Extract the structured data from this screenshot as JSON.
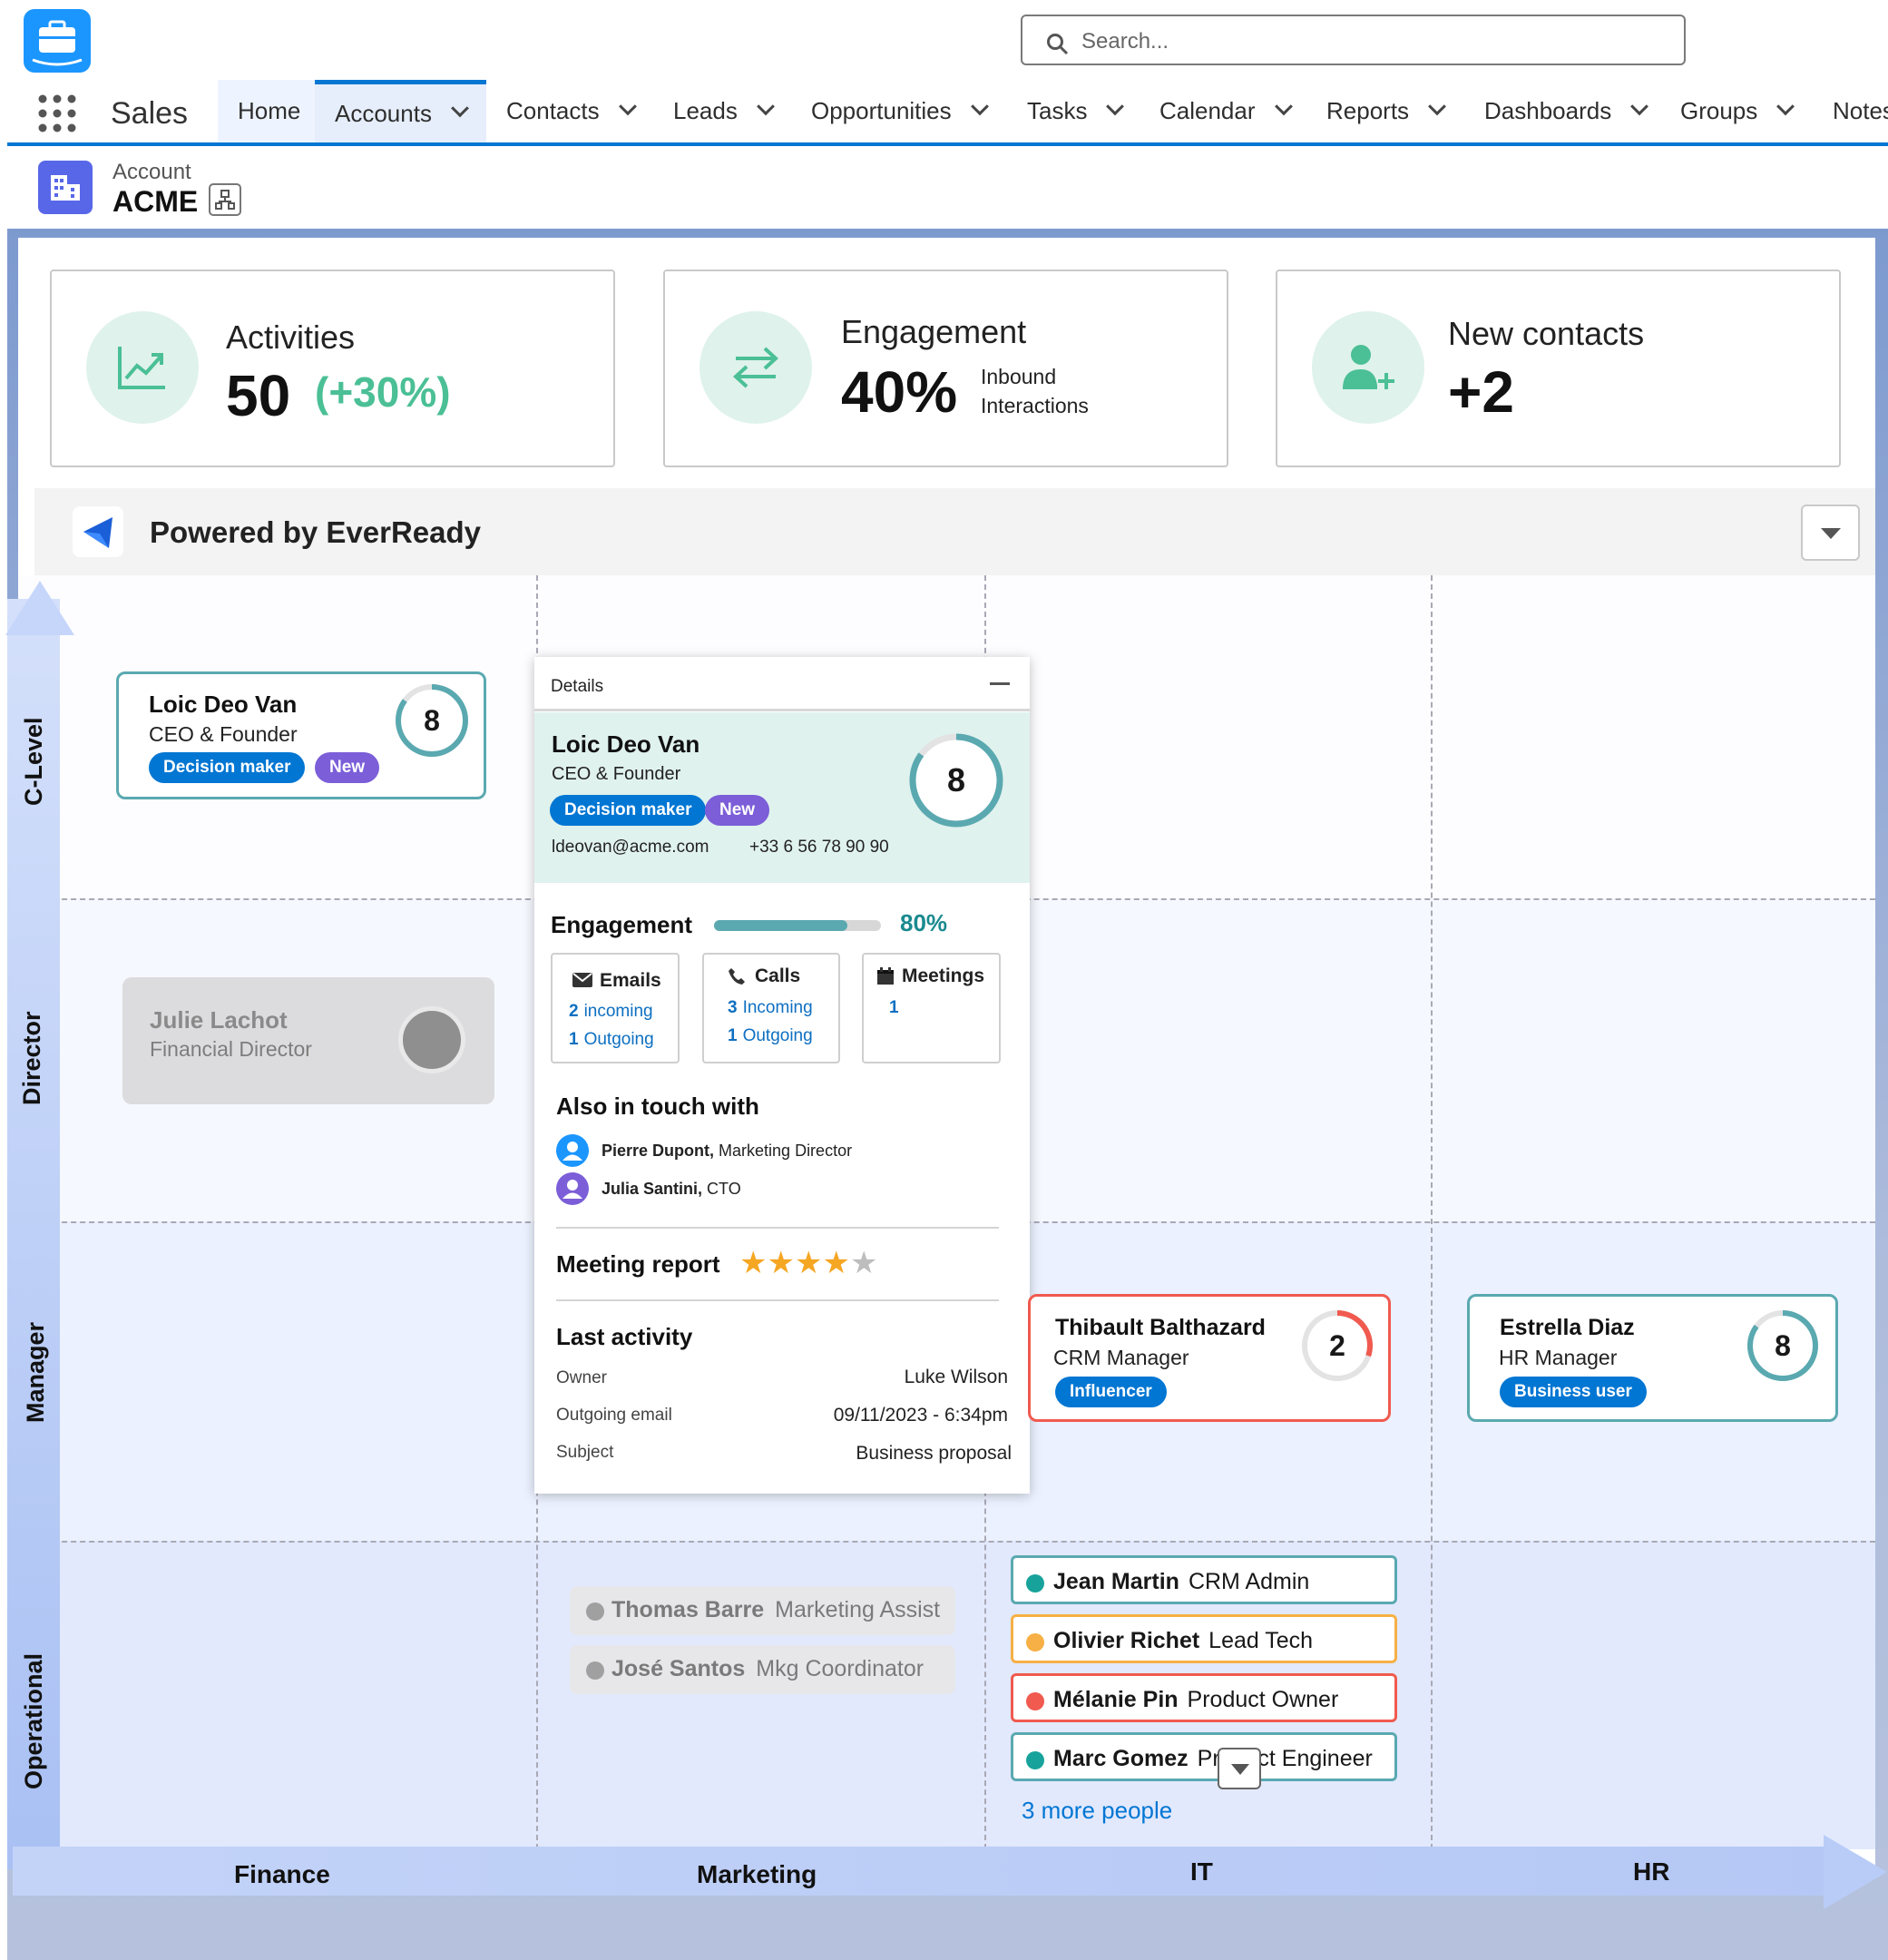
{
  "header": {
    "app_name": "Sales",
    "search_placeholder": "Search...",
    "nav": [
      {
        "label": "Home"
      },
      {
        "label": "Accounts"
      },
      {
        "label": "Contacts"
      },
      {
        "label": "Leads"
      },
      {
        "label": "Opportunities"
      },
      {
        "label": "Tasks"
      },
      {
        "label": "Calendar"
      },
      {
        "label": "Reports"
      },
      {
        "label": "Dashboards"
      },
      {
        "label": "Groups"
      },
      {
        "label": "Notes"
      }
    ]
  },
  "record": {
    "type_label": "Account",
    "name": "ACME"
  },
  "kpis": {
    "activities": {
      "title": "Activities",
      "value": "50",
      "change": "(+30%)"
    },
    "engagement": {
      "title": "Engagement",
      "value": "40%",
      "sub1": "Inbound",
      "sub2": "Interactions"
    },
    "new_contacts": {
      "title": "New contacts",
      "value": "+2"
    }
  },
  "powered_by": "Powered by EverReady",
  "y_axis": [
    "C-Level",
    "Director",
    "Manager",
    "Operational"
  ],
  "x_axis": [
    "Finance",
    "Marketing",
    "IT",
    "HR"
  ],
  "cards": {
    "loic": {
      "name": "Loic Deo Van",
      "role": "CEO & Founder",
      "badges": [
        "Decision maker",
        "New"
      ],
      "score": "8",
      "score_pct": 0.85
    },
    "julie": {
      "name": "Julie Lachot",
      "role": "Financial Director"
    },
    "thibault": {
      "name": "Thibault Balthazard",
      "role": "CRM Manager",
      "badge": "Influencer",
      "score": "2",
      "score_pct": 0.3
    },
    "estrella": {
      "name": "Estrella Diaz",
      "role": "HR Manager",
      "badge": "Business user",
      "score": "8",
      "score_pct": 0.85
    }
  },
  "details": {
    "header": "Details",
    "name": "Loic Deo Van",
    "role": "CEO & Founder",
    "badges": [
      "Decision maker",
      "New"
    ],
    "email": "ldeovan@acme.com",
    "phone": "+33 6 56 78 90 90",
    "score": "8",
    "score_pct": 0.85,
    "engagement_label": "Engagement",
    "engagement_value": "80%",
    "engagement_pct": 0.8,
    "channels": {
      "emails": {
        "title": "Emails",
        "in_n": "2",
        "in_label": "incoming",
        "out_n": "1",
        "out_label": "Outgoing"
      },
      "calls": {
        "title": "Calls",
        "in_n": "3",
        "in_label": "Incoming",
        "out_n": "1",
        "out_label": "Outgoing"
      },
      "meetings": {
        "title": "Meetings",
        "n": "1"
      }
    },
    "also_label": "Also in touch with",
    "contacts": [
      {
        "name": "Pierre Dupont,",
        "role": "Marketing Director"
      },
      {
        "name": "Julia Santini,",
        "role": "CTO"
      }
    ],
    "meeting_label": "Meeting report",
    "rating": 4,
    "rating_max": 5,
    "last_activity_label": "Last activity",
    "rows": [
      {
        "label": "Owner",
        "value": "Luke Wilson"
      },
      {
        "label": "Outgoing email",
        "value": "09/11/2023 - 6:34pm"
      },
      {
        "label": "Subject",
        "value": "Business proposal"
      }
    ]
  },
  "operational_marketing": [
    {
      "name": "Thomas Barre",
      "role": "Marketing Assist"
    },
    {
      "name": "José Santos",
      "role": "Mkg Coordinator"
    }
  ],
  "operational_it": [
    {
      "name": "Jean Martin",
      "role": "CRM Admin",
      "color": "#17a39b"
    },
    {
      "name": "Olivier Richet",
      "role": "Lead Tech",
      "color": "#f6b045"
    },
    {
      "name": "Mélanie Pin",
      "role": "Product Owner",
      "color": "#f05a4f"
    },
    {
      "name": "Marc Gomez",
      "role": "Product Engineer",
      "color": "#17a39b"
    }
  ],
  "more_people": "3 more people",
  "colors": {
    "brand": "#0176d3",
    "teal": "#5aa9b0",
    "green": "#4bbf96",
    "red": "#f05a4f",
    "orange": "#f6b045"
  }
}
